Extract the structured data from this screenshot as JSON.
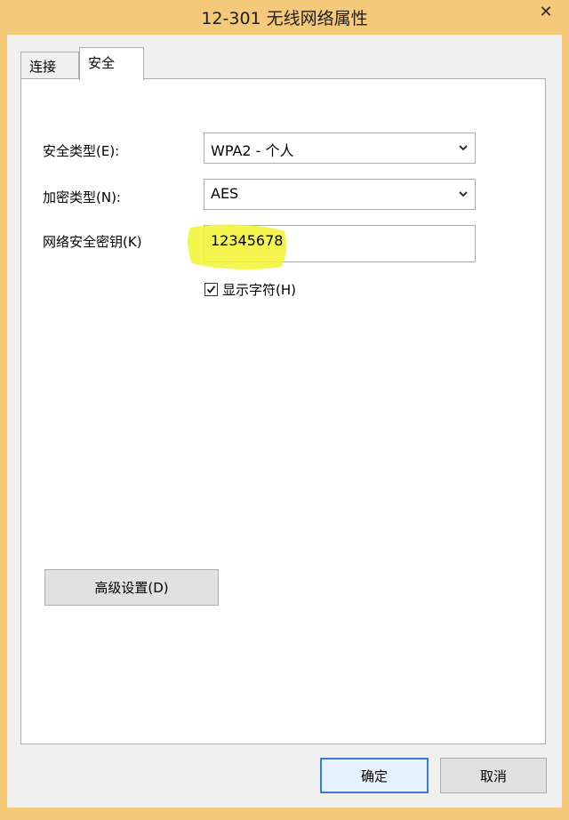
{
  "window": {
    "title": "12-301 无线网络属性",
    "close_glyph": "✕"
  },
  "tabs": [
    {
      "label": "连接",
      "active": false
    },
    {
      "label": "安全",
      "active": true
    }
  ],
  "security": {
    "security_type": {
      "label": "安全类型(E):",
      "value": "WPA2 - 个人"
    },
    "encryption_type": {
      "label": "加密类型(N):",
      "value": "AES"
    },
    "network_key": {
      "label": "网络安全密钥(K)",
      "value": "12345678",
      "highlight_color": "#f4f43c"
    },
    "show_characters": {
      "label": "显示字符(H)",
      "checked": true
    },
    "advanced_button": "高级设置(D)"
  },
  "footer": {
    "ok_label": "确定",
    "cancel_label": "取消"
  },
  "colors": {
    "frame": "#f5c97a",
    "client": "#f0f0f0",
    "focus_border": "#3d7bd4"
  },
  "icons": {
    "dropdown": "chevron-down-icon",
    "check": "checkmark-icon",
    "close": "close-icon"
  }
}
